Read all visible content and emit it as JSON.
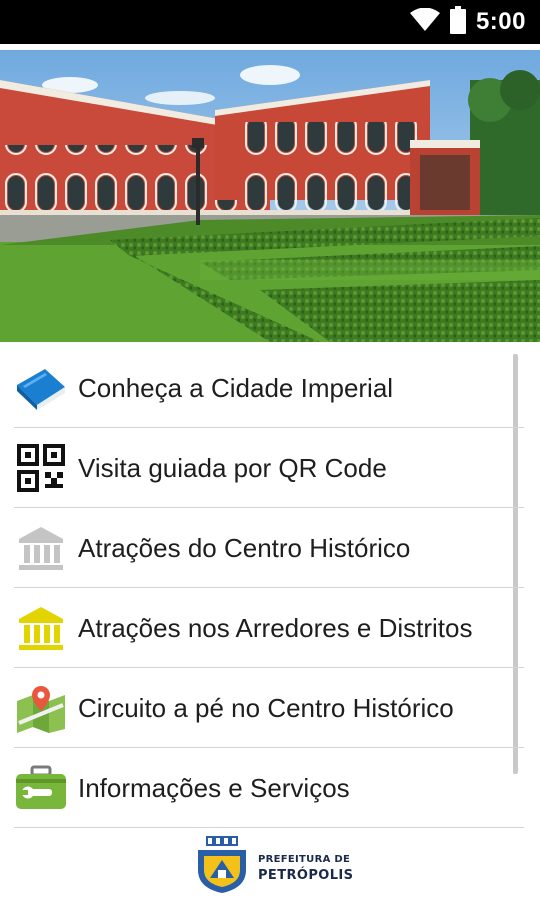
{
  "status_bar": {
    "time": "5:00",
    "icons": [
      "wifi-icon",
      "battery-icon"
    ]
  },
  "hero": {
    "image": "photo of the Imperial Museum palace with hedged garden"
  },
  "menu": {
    "items": [
      {
        "label": "Conheça a Cidade Imperial",
        "icon": "book-icon"
      },
      {
        "label": "Visita guiada por QR Code",
        "icon": "qr-code-icon"
      },
      {
        "label": "Atrações do Centro Histórico",
        "icon": "museum-gray-icon"
      },
      {
        "label": "Atrações nos Arredores e Distritos",
        "icon": "museum-yellow-icon"
      },
      {
        "label": "Circuito a pé no Centro Histórico",
        "icon": "map-pin-icon"
      },
      {
        "label": "Informações e Serviços",
        "icon": "toolbox-icon"
      }
    ]
  },
  "footer": {
    "logo_line1": "PREFEITURA DE",
    "logo_line2": "PETRÓPOLIS"
  },
  "colors": {
    "status_bar": "#000000",
    "text": "#1e1e1e",
    "divider": "#d4d4d4",
    "accent_yellow": "#e2d400",
    "accent_green": "#79b63c"
  }
}
